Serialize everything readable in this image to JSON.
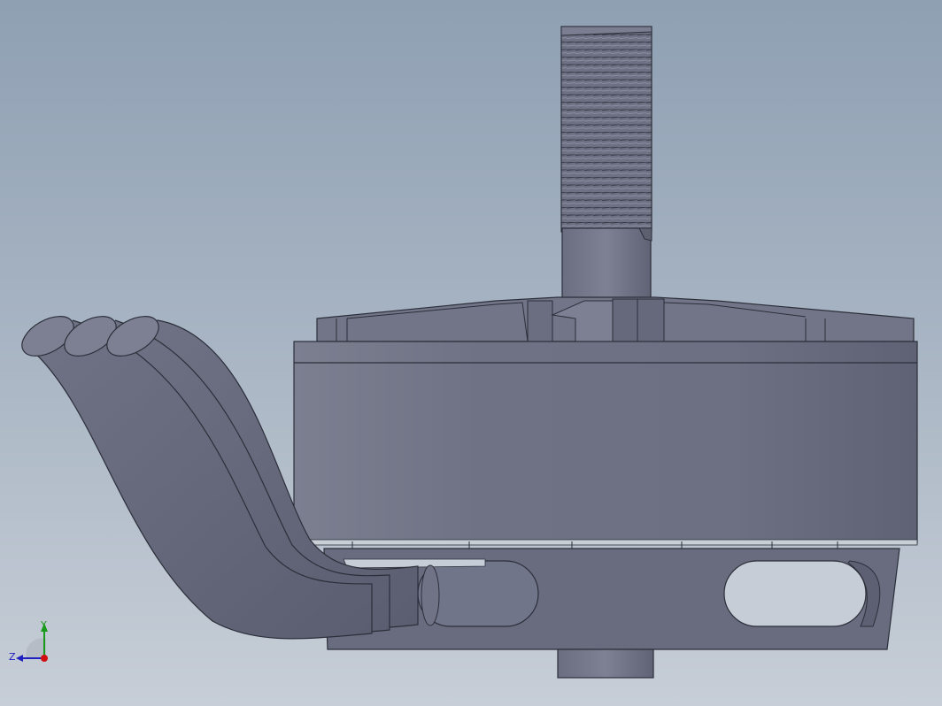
{
  "viewport": {
    "background_top": "#8fa0b3",
    "background_bottom": "#c7ced7",
    "model_color": "#6e7384"
  },
  "model": {
    "parts": [
      "threaded-shaft",
      "top-bell",
      "motor-can",
      "base-mount",
      "lead-wires",
      "bottom-shaft"
    ]
  },
  "triad": {
    "y_label": "Y",
    "z_label": "Z",
    "y_color": "#1a9a1a",
    "z_color": "#2020c0",
    "origin_color": "#d01010"
  }
}
